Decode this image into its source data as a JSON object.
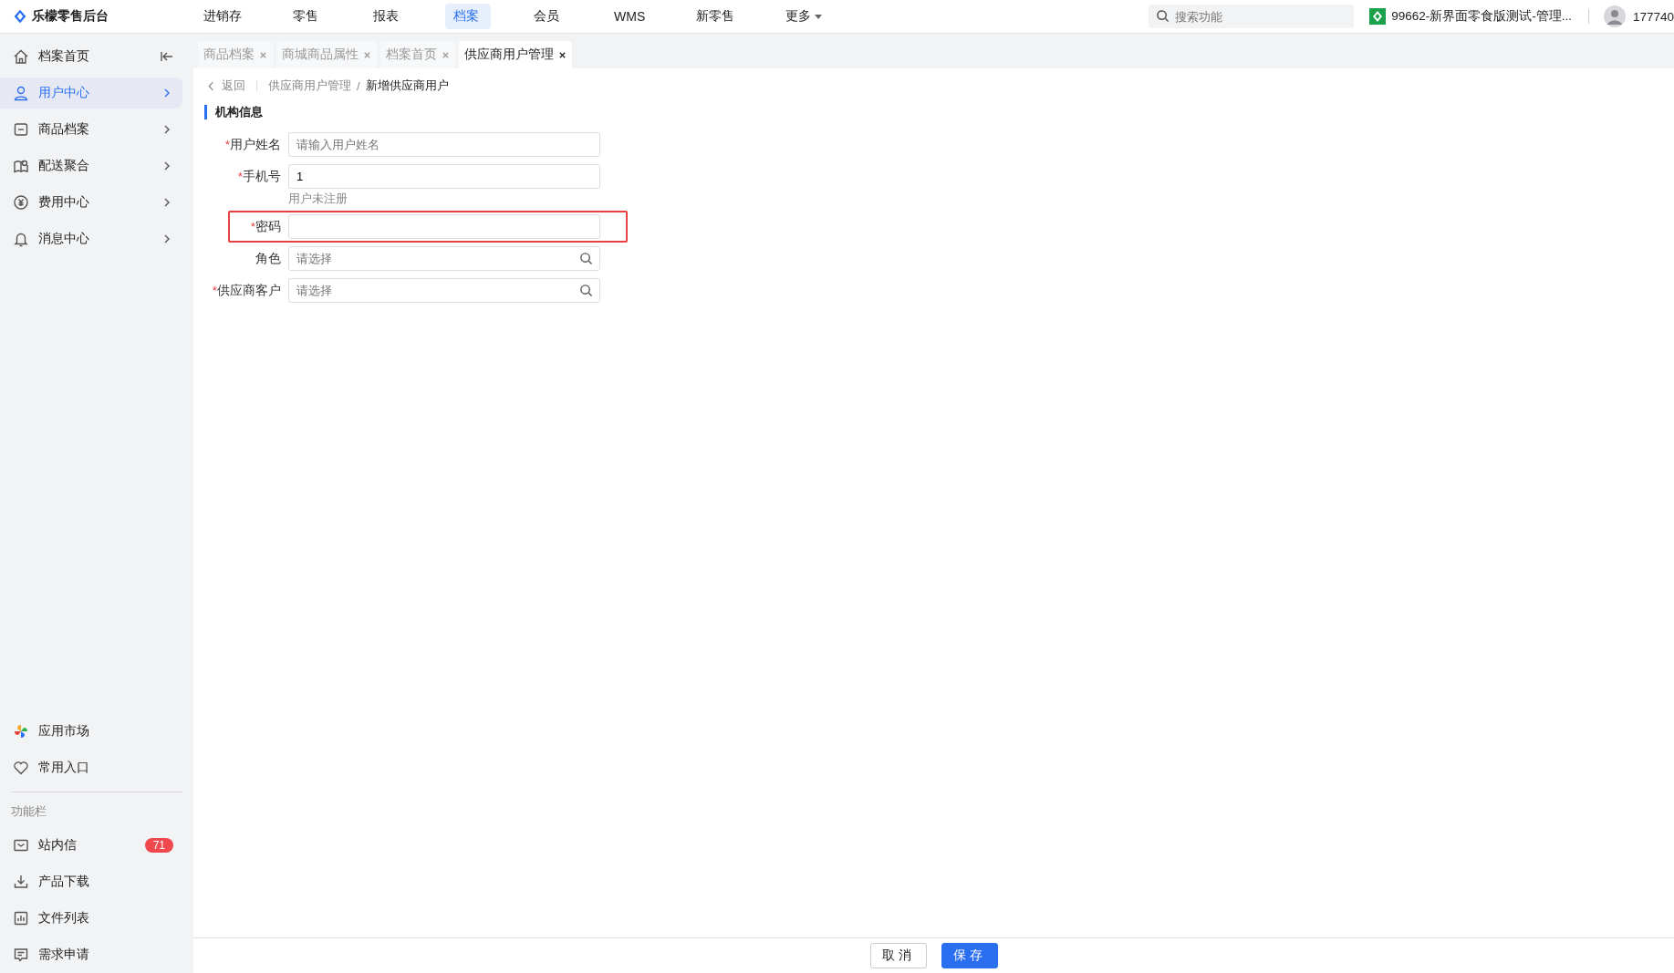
{
  "app": {
    "title": "乐檬零售后台"
  },
  "nav": [
    {
      "label": "进销存",
      "selected": false,
      "dropdown": false
    },
    {
      "label": "零售",
      "selected": false,
      "dropdown": false
    },
    {
      "label": "报表",
      "selected": false,
      "dropdown": false
    },
    {
      "label": "档案",
      "selected": true,
      "dropdown": false
    },
    {
      "label": "会员",
      "selected": false,
      "dropdown": false
    },
    {
      "label": "WMS",
      "selected": false,
      "dropdown": false
    },
    {
      "label": "新零售",
      "selected": false,
      "dropdown": false
    },
    {
      "label": "更多",
      "selected": false,
      "dropdown": true
    }
  ],
  "search": {
    "placeholder": "搜索功能"
  },
  "store": {
    "name": "99662-新界面零食版测试-管理..."
  },
  "user": {
    "name": "177740"
  },
  "sidebar": {
    "items": [
      {
        "label": "档案首页",
        "selected": false,
        "kind": "home"
      },
      {
        "label": "用户中心",
        "selected": true,
        "kind": "group"
      },
      {
        "label": "商品档案",
        "selected": false,
        "kind": "group"
      },
      {
        "label": "配送聚合",
        "selected": false,
        "kind": "group"
      },
      {
        "label": "费用中心",
        "selected": false,
        "kind": "group"
      },
      {
        "label": "消息中心",
        "selected": false,
        "kind": "group"
      }
    ],
    "bottom_items": [
      {
        "label": "应用市场"
      },
      {
        "label": "常用入口"
      }
    ],
    "section_title": "功能栏",
    "tools": [
      {
        "label": "站内信",
        "badge": "71"
      },
      {
        "label": "产品下载"
      },
      {
        "label": "文件列表"
      },
      {
        "label": "需求申请"
      }
    ]
  },
  "tabs": [
    {
      "label": "商品档案",
      "selected": false
    },
    {
      "label": "商城商品属性",
      "selected": false
    },
    {
      "label": "档案首页",
      "selected": false
    },
    {
      "label": "供应商用户管理",
      "selected": true
    }
  ],
  "breadcrumb": {
    "back": "返回",
    "separator": "/",
    "items": [
      "供应商用户管理",
      "新增供应商用户"
    ]
  },
  "form": {
    "title": "机构信息",
    "required_mark": "*",
    "fields": [
      {
        "label": "用户姓名",
        "required": true,
        "kind": "text",
        "placeholder": "请输入用户姓名",
        "highlighted": false
      },
      {
        "label": "手机号",
        "required": true,
        "kind": "text",
        "value": "1",
        "hint": "用户未注册",
        "highlighted": false
      },
      {
        "label": "密码",
        "required": true,
        "kind": "text",
        "highlighted": true
      },
      {
        "label": "角色",
        "required": false,
        "kind": "lookup",
        "placeholder": "请选择",
        "highlighted": false
      },
      {
        "label": "供应商客户",
        "required": true,
        "kind": "lookup",
        "placeholder": "请选择",
        "highlighted": false
      }
    ]
  },
  "footer": {
    "buttons": [
      {
        "label": "取消",
        "kind": "secondary"
      },
      {
        "label": "保存",
        "kind": "primary"
      }
    ]
  }
}
